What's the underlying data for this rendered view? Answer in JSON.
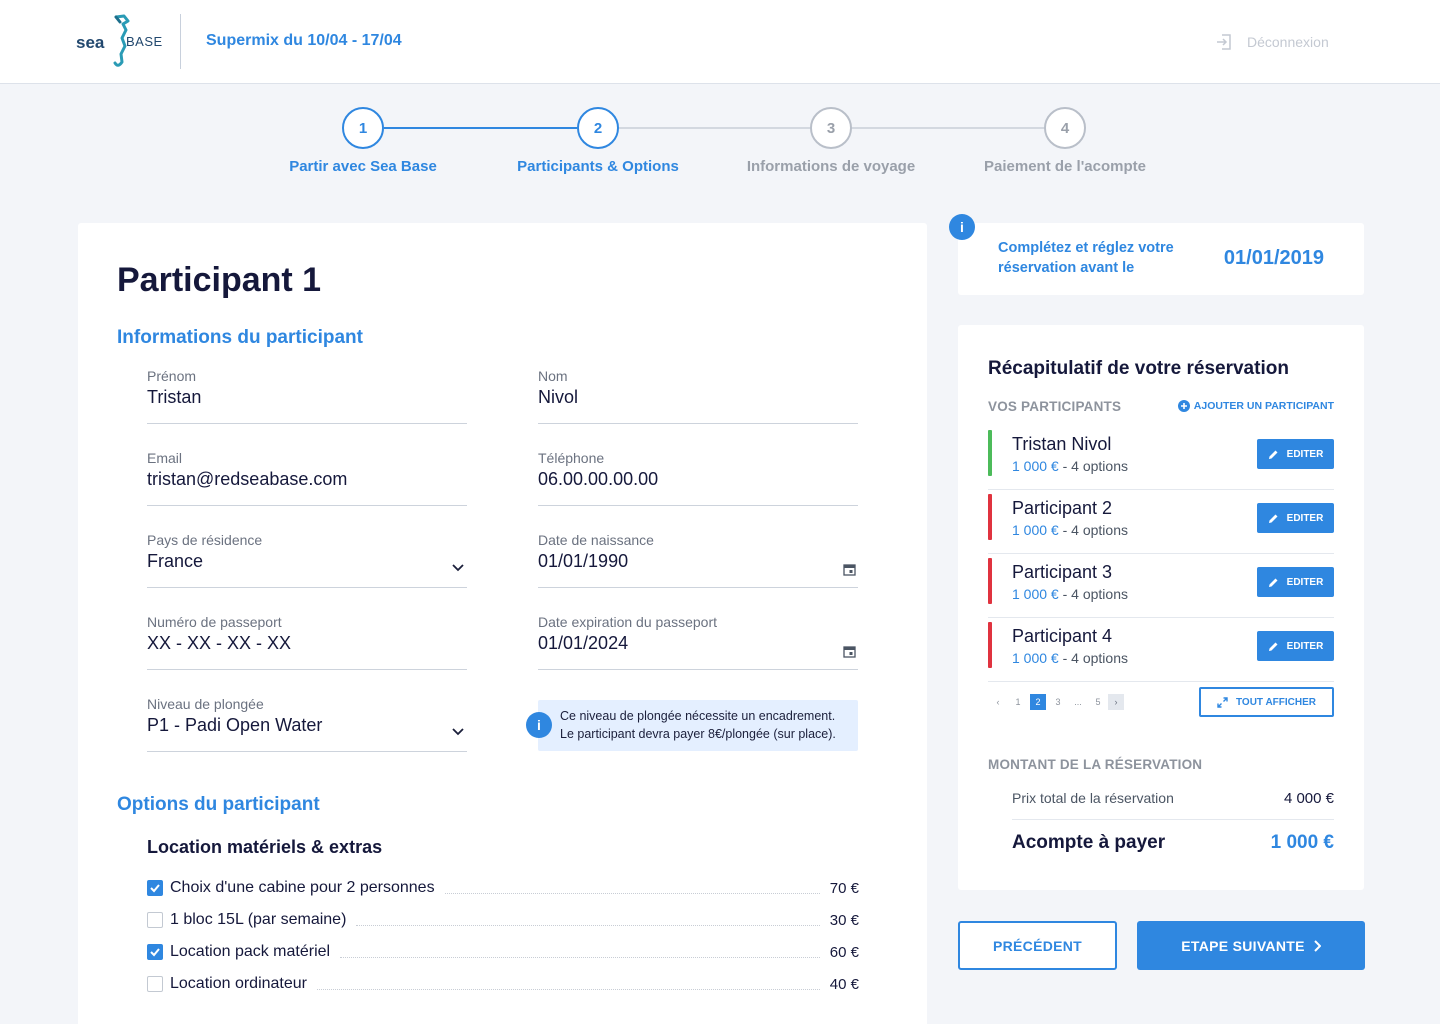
{
  "header": {
    "logo_sea": "sea",
    "logo_base": "BASE",
    "trip_title": "Supermix du 10/04 - 17/04",
    "logout_label": "Déconnexion"
  },
  "stepper": {
    "steps": [
      {
        "number": "1",
        "label": "Partir avec Sea Base",
        "state": "done"
      },
      {
        "number": "2",
        "label": "Participants & Options",
        "state": "current"
      },
      {
        "number": "3",
        "label": "Informations de voyage",
        "state": "upcoming"
      },
      {
        "number": "4",
        "label": "Paiement de l'acompte",
        "state": "upcoming"
      }
    ]
  },
  "participant_form": {
    "title": "Participant 1",
    "info_section_title": "Informations du participant",
    "fields": {
      "first_name": {
        "label": "Prénom",
        "value": "Tristan"
      },
      "last_name": {
        "label": "Nom",
        "value": "Nivol"
      },
      "email": {
        "label": "Email",
        "value": "tristan@redseabase.com"
      },
      "phone": {
        "label": "Téléphone",
        "value": "06.00.00.00.00"
      },
      "country": {
        "label": "Pays de résidence",
        "value": "France"
      },
      "birth_date": {
        "label": "Date de naissance",
        "value": "01/01/1990"
      },
      "passport_number": {
        "label": "Numéro de passeport",
        "value": "XX - XX - XX - XX"
      },
      "passport_expiry": {
        "label": "Date expiration du passeport",
        "value": "01/01/2024"
      },
      "dive_level": {
        "label": "Niveau de plongée",
        "value": "P1 - Padi Open Water"
      }
    },
    "dive_level_note_line1": "Ce niveau de plongée nécessite un encadrement.",
    "dive_level_note_line2": "Le participant devra payer 8€/plongée (sur place).",
    "options_section_title": "Options du participant",
    "options_subtitle": "Location matériels & extras",
    "options": [
      {
        "label": "Choix d'une cabine pour 2 personnes",
        "price": "70 €",
        "checked": true
      },
      {
        "label": "1 bloc 15L (par semaine)",
        "price": "30 €",
        "checked": false
      },
      {
        "label": "Location pack matériel",
        "price": "60 €",
        "checked": true
      },
      {
        "label": "Location ordinateur",
        "price": "40 €",
        "checked": false
      }
    ]
  },
  "deadline": {
    "text": "Complétez et réglez votre réservation avant le",
    "date": "01/01/2019"
  },
  "recap": {
    "title": "Récapitulatif de votre réservation",
    "participants_heading": "VOS PARTICIPANTS",
    "add_participant_label": "AJOUTER UN PARTICIPANT",
    "participants": [
      {
        "name": "Tristan Nivol",
        "price": "1 000 €",
        "options": "- 4 options",
        "status_color": "#4cbb5a"
      },
      {
        "name": "Participant 2",
        "price": "1 000 €",
        "options": "- 4 options",
        "status_color": "#e0333f"
      },
      {
        "name": "Participant 3",
        "price": "1 000 €",
        "options": "- 4 options",
        "status_color": "#e0333f"
      },
      {
        "name": "Participant 4",
        "price": "1 000 €",
        "options": "- 4 options",
        "status_color": "#e0333f"
      }
    ],
    "edit_label": "EDITER",
    "pagination": {
      "prev": "‹",
      "pages": [
        "1",
        "2",
        "3",
        "...",
        "5"
      ],
      "current": "2",
      "next": "›"
    },
    "show_all_label": "TOUT AFFICHER",
    "amount_heading": "MONTANT DE LA RÉSERVATION",
    "total_label": "Prix total de la réservation",
    "total_value": "4 000 €",
    "deposit_label": "Acompte à payer",
    "deposit_value": "1 000 €"
  },
  "nav": {
    "previous_label": "PRÉCÉDENT",
    "next_label": "ETAPE SUIVANTE"
  },
  "colors": {
    "accent": "#2f87e0",
    "status_ok": "#4cbb5a",
    "status_missing": "#e0333f",
    "background": "#f3f5f9"
  }
}
